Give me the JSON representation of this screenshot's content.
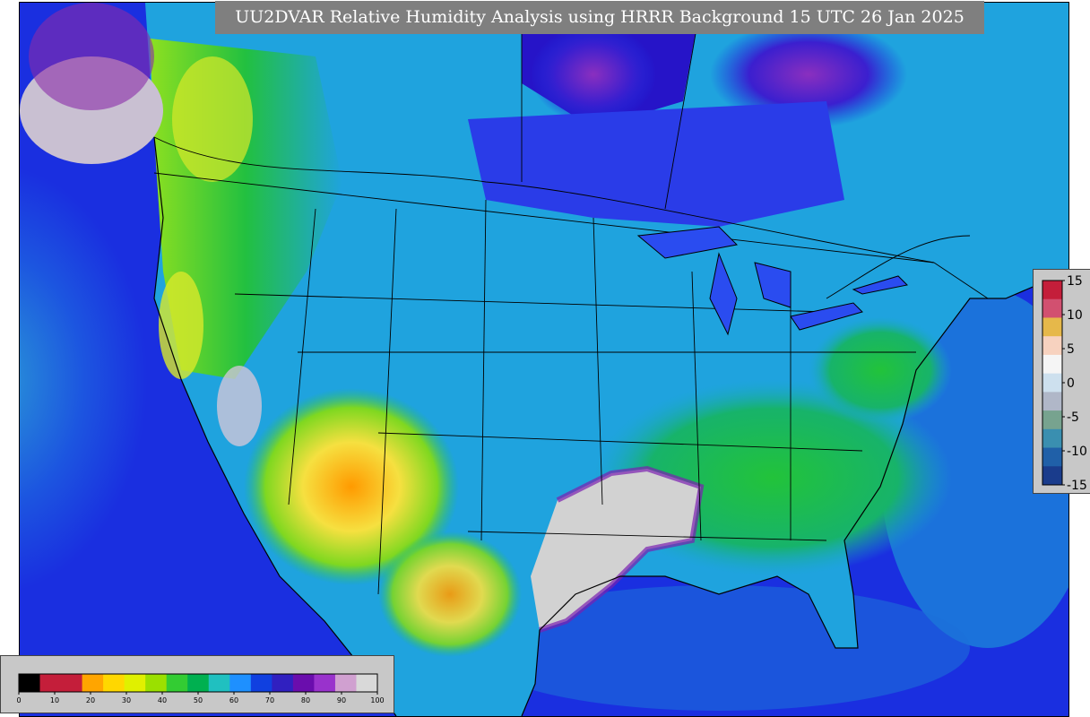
{
  "title": "UU2DVAR Relative Humidity Analysis using HRRR Background 15 UTC 26 Jan 2025",
  "map": {
    "region": "CONUS",
    "colors": {
      "ocean": "#1a2fe0",
      "land_base": "#20a8e0",
      "moist_high": "#cfcfcf",
      "dry": "#f0e040",
      "boundary": "#000000"
    }
  },
  "rh_colorbar": {
    "ticks": [
      "0",
      "10",
      "20",
      "30",
      "40",
      "50",
      "60",
      "70",
      "80",
      "90",
      "100"
    ],
    "range": [
      0,
      100
    ],
    "colors": [
      "#000000",
      "#c41e3a",
      "#c41e3a",
      "#ffa500",
      "#ffd700",
      "#e0f000",
      "#9be000",
      "#33cc33",
      "#00b050",
      "#20c0c0",
      "#1e90ff",
      "#1040e0",
      "#3020c0",
      "#6a0dad",
      "#9932cc",
      "#d0a0d0",
      "#d9d9d9"
    ]
  },
  "increment_colorbar": {
    "ticks": [
      "15",
      "10",
      "5",
      "0",
      "-5",
      "-10",
      "-15"
    ],
    "range": [
      -15,
      15
    ],
    "colors": [
      "#c41e3a",
      "#d25070",
      "#e6b84a",
      "#f7d2bf",
      "#f5f5f5",
      "#cde0ee",
      "#b0b7c8",
      "#77a38f",
      "#3a8fb0",
      "#2060a8",
      "#1a3c8c"
    ]
  }
}
